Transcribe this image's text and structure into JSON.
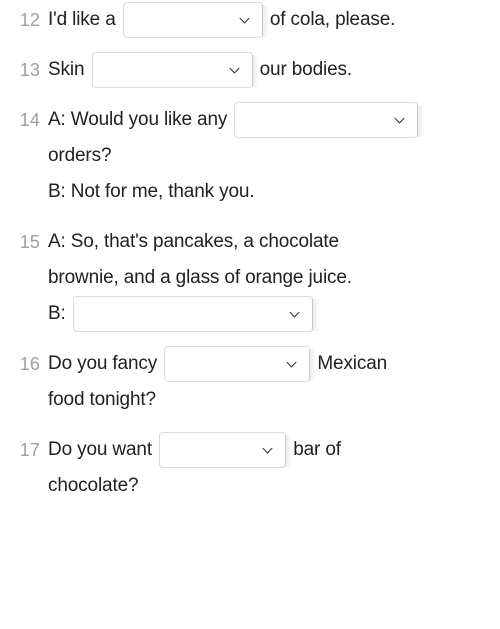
{
  "page": {
    "background_color": "#ffffff",
    "number_color": "#9aa0a6",
    "text_color": "#202124",
    "dropdown_border_color": "#dadce0",
    "chevron_color": "#3c4043"
  },
  "questions": [
    {
      "number": "12",
      "lines": [
        {
          "parts": [
            {
              "kind": "text",
              "value": "I'd like a "
            },
            {
              "kind": "dropdown",
              "value": "",
              "width_class": "dd-w162"
            },
            {
              "kind": "text",
              "value": " of cola, please."
            }
          ]
        }
      ]
    },
    {
      "number": "13",
      "lines": [
        {
          "parts": [
            {
              "kind": "text",
              "value": "Skin "
            },
            {
              "kind": "dropdown",
              "value": "",
              "width_class": "dd-w161"
            },
            {
              "kind": "text",
              "value": " our bodies."
            }
          ]
        }
      ]
    },
    {
      "number": "14",
      "lines": [
        {
          "parts": [
            {
              "kind": "text",
              "value": "A: Would you like any "
            },
            {
              "kind": "dropdown",
              "value": "",
              "width_class": "dd-w184"
            }
          ]
        },
        {
          "parts": [
            {
              "kind": "text",
              "value": "orders?"
            }
          ]
        },
        {
          "parts": [
            {
              "kind": "text",
              "value": "B: Not for me, thank you."
            }
          ]
        }
      ]
    },
    {
      "number": "15",
      "lines": [
        {
          "parts": [
            {
              "kind": "text",
              "value": "A: So, that's pancakes, a chocolate"
            }
          ]
        },
        {
          "parts": [
            {
              "kind": "text",
              "value": "brownie, and a glass of orange juice."
            }
          ]
        },
        {
          "parts": [
            {
              "kind": "text",
              "value": "B: "
            },
            {
              "kind": "dropdown",
              "value": "",
              "width_class": "dd-w240"
            }
          ]
        }
      ]
    },
    {
      "number": "16",
      "lines": [
        {
          "parts": [
            {
              "kind": "text",
              "value": "Do you fancy "
            },
            {
              "kind": "dropdown",
              "value": "",
              "width_class": "dd-w146"
            },
            {
              "kind": "text",
              "value": " Mexican"
            }
          ]
        },
        {
          "parts": [
            {
              "kind": "text",
              "value": "food tonight?"
            }
          ]
        }
      ]
    },
    {
      "number": "17",
      "lines": [
        {
          "parts": [
            {
              "kind": "text",
              "value": "Do you want "
            },
            {
              "kind": "dropdown",
              "value": "",
              "width_class": "dd-w127"
            },
            {
              "kind": "text",
              "value": " bar of"
            }
          ]
        },
        {
          "parts": [
            {
              "kind": "text",
              "value": "chocolate?"
            }
          ]
        }
      ]
    }
  ],
  "icons": {
    "chevron_down": "chevron-down-icon"
  }
}
